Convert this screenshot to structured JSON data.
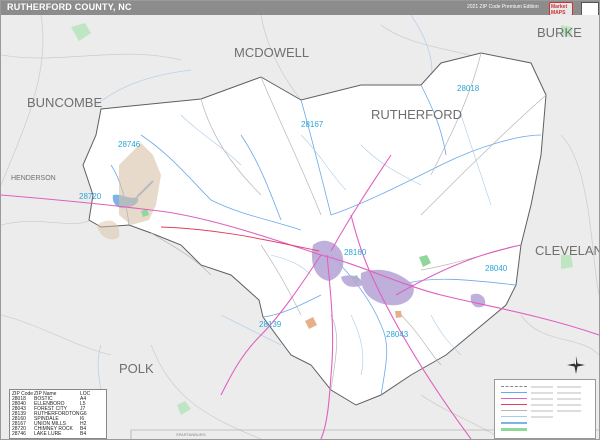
{
  "header": {
    "title": "RUTHERFORD COUNTY, NC",
    "edition": "2021 ZIP Code Premium Edition",
    "logo_text": "Market MAPS"
  },
  "colors": {
    "county_fill": "#ffffff",
    "outside_fill": "#ececec",
    "zip_label": "#2ba5d6",
    "county_label": "#6f6f6f",
    "roads_pink": "#e060c0",
    "city_purple": "#b9a8d8",
    "water_blue": "#7fb3e6",
    "park_green": "#8fd79a",
    "zip_boundary": "#6aa9e9"
  },
  "map": {
    "county_labels": [
      {
        "name": "MCDOWELL"
      },
      {
        "name": "BURKE"
      },
      {
        "name": "BUNCOMBE"
      },
      {
        "name": "RUTHERFORD"
      },
      {
        "name": "HENDERSON"
      },
      {
        "name": "CLEVELAND"
      },
      {
        "name": "POLK"
      }
    ],
    "zip_labels": [
      "28018",
      "28167",
      "28746",
      "28720",
      "28160",
      "28040",
      "28139",
      "28043"
    ],
    "places": [
      "SPARTANBURG"
    ]
  },
  "legend": {
    "headers": [
      "ZIP Code",
      "ZIP Name",
      "LOC"
    ],
    "rows": [
      [
        "28018",
        "BOSTIC",
        "A4"
      ],
      [
        "28040",
        "ELLENBORO",
        "L5"
      ],
      [
        "28043",
        "FOREST CITY",
        "J7"
      ],
      [
        "28139",
        "RUTHERFORDTON",
        "G6"
      ],
      [
        "28160",
        "SPINDALE",
        "I6"
      ],
      [
        "28167",
        "UNION MILLS",
        "H2"
      ],
      [
        "28720",
        "CHIMNEY ROCK",
        "B4"
      ],
      [
        "28746",
        "LAKE LURE",
        "B4"
      ]
    ]
  }
}
